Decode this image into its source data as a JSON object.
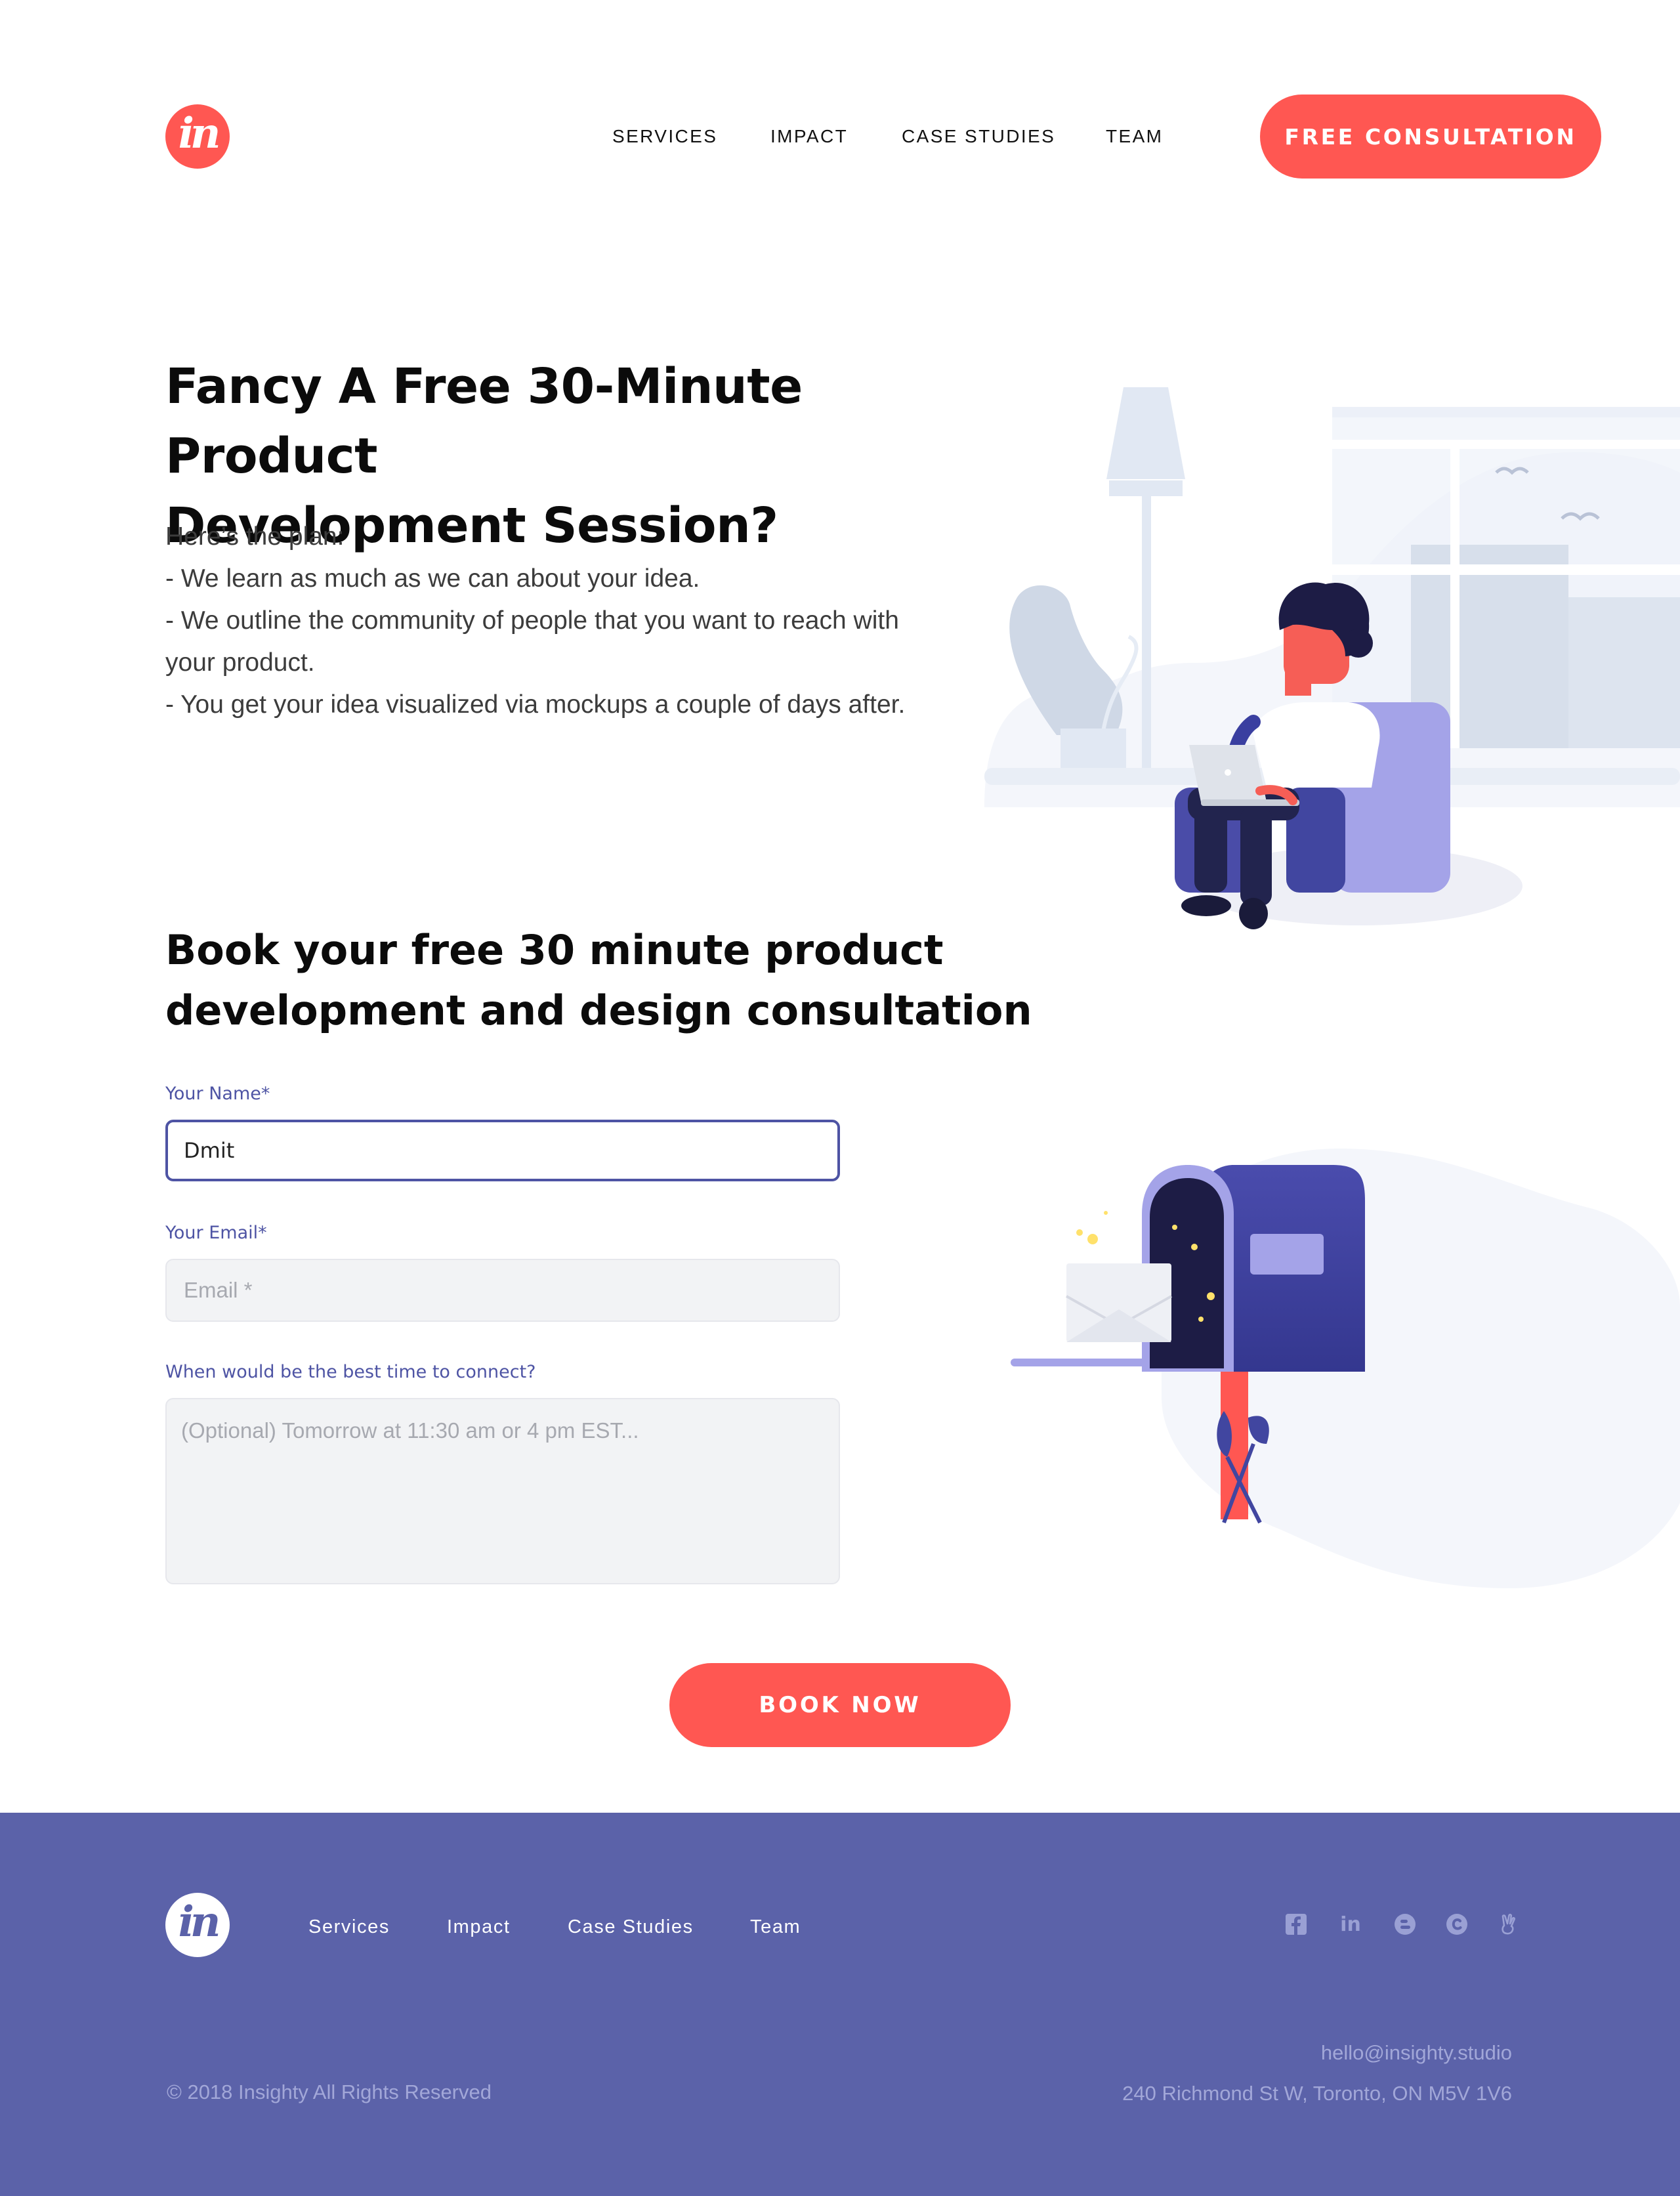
{
  "header": {
    "logo_text": "in",
    "nav": [
      "SERVICES",
      "IMPACT",
      "CASE STUDIES",
      "TEAM"
    ],
    "cta_label": "FREE CONSULTATION"
  },
  "hero": {
    "title_line1": "Fancy A Free 30-Minute Product",
    "title_line2": "Development Session?",
    "plan_intro": "Here’s the plan:",
    "plan_items": [
      "- We learn as much as we can about your idea.",
      "- We outline the community of people that you want to reach with your product.",
      "- You get your idea visualized via mockups a couple of days after."
    ]
  },
  "form": {
    "title_line1": "Book your free 30 minute product",
    "title_line2": "development and design consultation",
    "name_label": "Your Name*",
    "name_value": "Dmit",
    "email_label": "Your Email*",
    "email_placeholder": "Email *",
    "time_label": "When would be the best time to connect?",
    "time_placeholder": "(Optional) Tomorrow at 11:30 am or 4 pm EST...",
    "submit_label": "BOOK NOW"
  },
  "footer": {
    "logo_text": "in",
    "nav": [
      "Services",
      "Impact",
      "Case Studies",
      "Team"
    ],
    "social_icons": [
      "facebook-icon",
      "linkedin-icon",
      "blogger-icon",
      "behance-icon",
      "angellist-icon"
    ],
    "linkedin_glyph": "in",
    "copyright": "© 2018 Insighty All Rights Reserved",
    "email": "hello@insighty.studio",
    "address": "240 Richmond St W, Toronto, ON M5V 1V6"
  },
  "colors": {
    "accent": "#ff5752",
    "primary": "#4e54a4",
    "footer_bg": "#5b62a9"
  }
}
